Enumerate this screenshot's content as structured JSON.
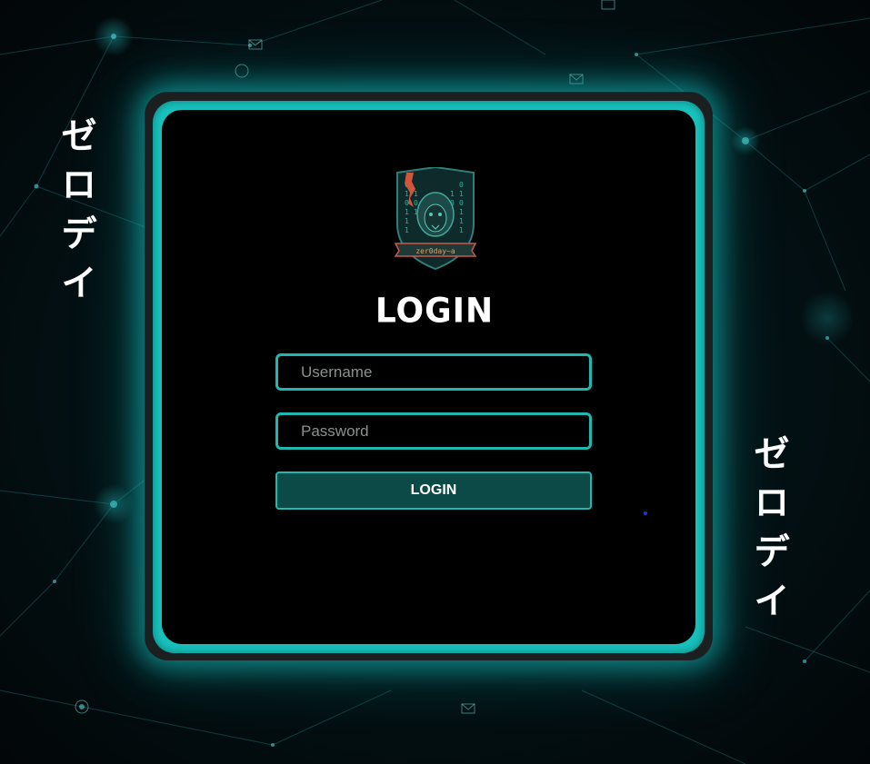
{
  "side_text": {
    "left": "ゼロデイ",
    "right": "ゼロデイ"
  },
  "logo": {
    "icon": "lion-shield-logo-icon",
    "banner_text": "zer0day~a"
  },
  "login": {
    "title": "LOGIN",
    "username_placeholder": "Username",
    "password_placeholder": "Password",
    "button_label": "LOGIN"
  },
  "colors": {
    "accent": "#19c2bd",
    "button_bg": "#0b4a47",
    "card_bg": "#000000",
    "page_bg": "#031114"
  }
}
